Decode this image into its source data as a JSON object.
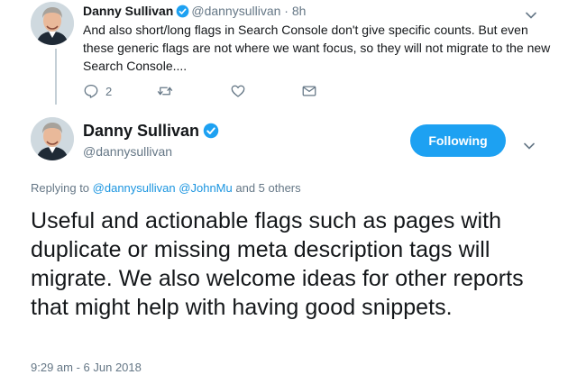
{
  "parent_tweet": {
    "name": "Danny Sullivan",
    "handle": "@dannysullivan",
    "separator": "·",
    "age": "8h",
    "text": "And also short/long flags in Search Console don't give specific counts. But even these generic flags are not where we want focus, so they will not migrate to the new Search Console....",
    "reply_count": "2",
    "retweet_count": "",
    "like_count": ""
  },
  "main_tweet": {
    "name": "Danny Sullivan",
    "handle": "@dannysullivan",
    "follow_label": "Following",
    "replying_prefix": "Replying to",
    "replying_user_1": "@dannysullivan",
    "replying_user_2": "@JohnMu",
    "replying_suffix": "and 5 others",
    "text": "Useful and actionable flags such as pages with duplicate or missing meta description tags will migrate. We also welcome ideas for other reports that might help with having good snippets.",
    "timestamp": "9:29 am - 6 Jun 2018"
  },
  "icons": {
    "verified": "verified-badge-icon",
    "reply": "reply-icon",
    "retweet": "retweet-icon",
    "like": "heart-icon",
    "dm": "envelope-icon",
    "caret": "chevron-down-icon"
  },
  "colors": {
    "accent": "#1da1f2",
    "link": "#1b95e0",
    "muted": "#657786",
    "text": "#14171a",
    "thread_line": "#c4cfd6"
  }
}
